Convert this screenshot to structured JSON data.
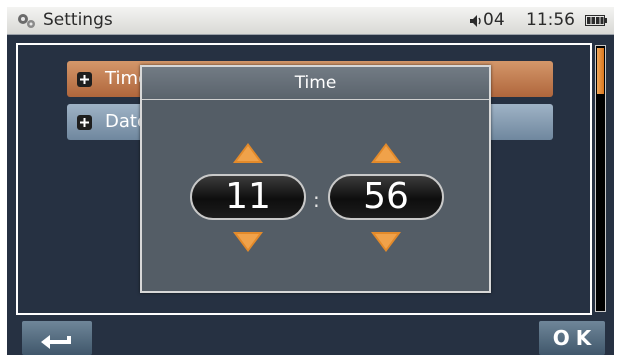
{
  "status_bar": {
    "title": "Settings",
    "volume": "04",
    "time": "11:56",
    "icons": [
      "gear-icon",
      "speaker-icon",
      "battery-icon"
    ]
  },
  "menu": {
    "items": [
      {
        "label": "Time",
        "icon": "plus-icon",
        "selected": true
      },
      {
        "label": "Date",
        "icon": "plus-icon",
        "selected": false
      }
    ]
  },
  "dialog": {
    "title": "Time",
    "hours": "11",
    "separator": ":",
    "minutes": "56",
    "icons": [
      "arrow-up-icon",
      "arrow-down-icon"
    ]
  },
  "footer": {
    "back_icon": "back-arrow-icon",
    "ok_label": "OK"
  },
  "colors": {
    "accent": "#e38a2a",
    "selected_row": "#c07a4c",
    "row": "#8aa0b6",
    "background": "#263142"
  }
}
